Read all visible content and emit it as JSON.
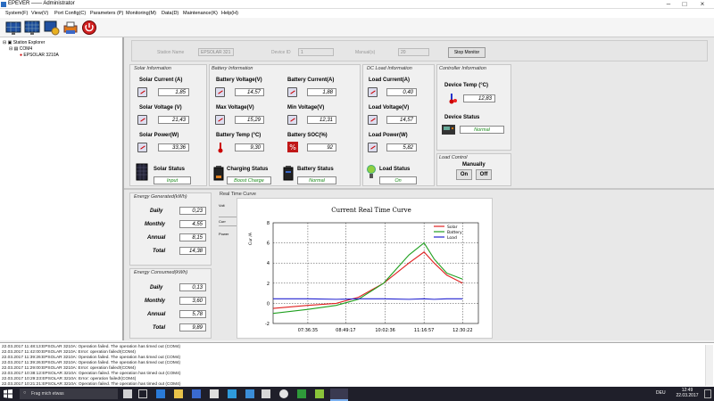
{
  "window": {
    "title": "EPEVER —— Administrator"
  },
  "menu": [
    "System(F)",
    "View(V)",
    "Port Config(C)",
    "Parameters (P)",
    "Monitoring(M)",
    "Data(D)",
    "Maintenance(K)",
    "Help(H)"
  ],
  "tree": {
    "root": "Station Explorer",
    "port": "COM4",
    "device": "EPSOLAR 3210A"
  },
  "device_bar": {
    "name_label": "Station Name",
    "name_value": "EPSOLAR 321",
    "id_label": "Device ID",
    "id_value": "1",
    "manual_label": "Manual(s)",
    "manual_value": "20",
    "stop_button": "Stop Monitor"
  },
  "solar": {
    "title": "Solar Information",
    "current_label": "Solar Current (A)",
    "current": "1,85",
    "voltage_label": "Solar Voltage (V)",
    "voltage": "21,43",
    "power_label": "Solar Power(W)",
    "power": "33,36",
    "status_label": "Solar Status",
    "status": "Input"
  },
  "battery": {
    "title": "Battery Information",
    "voltage_label": "Battery Voltage(V)",
    "voltage": "14,57",
    "current_label": "Battery Current(A)",
    "current": "1,88",
    "max_label": "Max Voltage(V)",
    "max": "15,29",
    "min_label": "Min Voltage(V)",
    "min": "12,31",
    "temp_label": "Battery Temp (°C)",
    "temp": "9,30",
    "soc_label": "Battery SOC(%)",
    "soc": "92",
    "charging_label": "Charging Status",
    "charging": "Boost Charge",
    "status_label": "Battery Status",
    "status": "Normal"
  },
  "load": {
    "title": "DC Load Information",
    "current_label": "Load Current(A)",
    "current": "0,40",
    "voltage_label": "Load Voltage(V)",
    "voltage": "14,57",
    "power_label": "Load Power(W)",
    "power": "5,82",
    "status_label": "Load Status",
    "status": "On"
  },
  "controller": {
    "title": "Controller Information",
    "temp_label": "Device Temp (°C)",
    "temp": "12,83",
    "status_label": "Device Status",
    "status": "Normal"
  },
  "load_control": {
    "title": "Load Control",
    "manually_label": "Manually",
    "on": "On",
    "off": "Off"
  },
  "energy_generated": {
    "title": "Energy Generated(kWh)",
    "daily_label": "Daily",
    "daily": "0,23",
    "monthly_label": "Monthly",
    "monthly": "4,55",
    "annual_label": "Annual",
    "annual": "8,15",
    "total_label": "Total",
    "total": "14,38"
  },
  "energy_consumed": {
    "title": "Energy Consumed(kWh)",
    "daily_label": "Daily",
    "daily": "0,13",
    "monthly_label": "Monthly",
    "monthly": "3,60",
    "annual_label": "Annual",
    "annual": "5,78",
    "total_label": "Total",
    "total": "9,89"
  },
  "realtime": {
    "title": "Real Time Curve",
    "tabs": [
      "Volt",
      "Curr",
      "Power"
    ]
  },
  "chart_data": {
    "type": "line",
    "title": "Current Real Time Curve",
    "ylabel": "Cur /A",
    "ylim": [
      -2,
      8
    ],
    "yticks": [
      "-2",
      "0",
      "2",
      "4",
      "6",
      "8"
    ],
    "xticks": [
      "07:36:35",
      "08:49:17",
      "10:02:36",
      "11:16:57",
      "12:30:22"
    ],
    "legend_position": "top-right",
    "grid": true,
    "x_hours": [
      6.5,
      7.6,
      8.5,
      9.2,
      10.0,
      10.8,
      11.28,
      11.6,
      12.0,
      12.5
    ],
    "series": [
      {
        "name": "Solar",
        "color": "#e02020",
        "values": [
          -0.5,
          -0.2,
          0.0,
          0.6,
          2.0,
          4.0,
          5.1,
          4.0,
          2.8,
          2.0
        ]
      },
      {
        "name": "Battery",
        "color": "#20a020",
        "values": [
          -1.0,
          -0.6,
          -0.2,
          0.4,
          2.0,
          4.8,
          6.0,
          4.4,
          3.0,
          2.4
        ]
      },
      {
        "name": "Load",
        "color": "#2020d0",
        "values": [
          0.45,
          0.45,
          0.4,
          0.45,
          0.45,
          0.4,
          0.45,
          0.4,
          0.45,
          0.45
        ]
      }
    ]
  },
  "log": [
    "22.03.2017 11:48:13:EPSOLAR 3210A: Operation failed. The operation has timed out (COM4)",
    "22.03.2017 11:42:00:EPSOLAR 3210A: Error: operation failed!(COM4)",
    "22.03.2017 11:39:26:EPSOLAR 3210A: Operation failed. The operation has timed out (COM4)",
    "22.03.2017 11:39:26:EPSOLAR 3210A: Operation failed. The operation has timed out (COM4)",
    "22.03.2017 11:29:00:EPSOLAR 3210A: Error: operation failed!(COM4)",
    "22.03.2017 10:38:12:EPSOLAR 3210A: Operation failed. The operation has timed out (COM4)",
    "22.03.2017 10:29:23:EPSOLAR 3210A: Error: operation failed!(COM4)",
    "22.03.2017 10:21:21:EPSOLAR 3210A: Operation failed. The operation has timed out (COM4)"
  ],
  "taskbar": {
    "search": "Frag mich etwas",
    "lang": "DEU",
    "time": "12:49",
    "date": "22.03.2017"
  }
}
